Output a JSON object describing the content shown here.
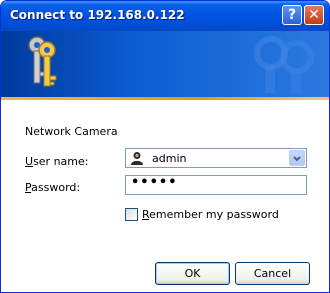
{
  "window": {
    "title": "Connect to 192.168.0.122"
  },
  "titlebar": {
    "help_icon": "help-icon",
    "close_icon": "close-icon"
  },
  "banner": {
    "icon": "keys-icon"
  },
  "form": {
    "realm": "Network Camera",
    "user_label_u": "U",
    "user_label_rest": "ser name:",
    "user_value": "admin",
    "user_icon": "user-icon",
    "password_label_u": "P",
    "password_label_rest": "assword:",
    "password_value": "•••••",
    "remember_u": "R",
    "remember_rest": "emember my password",
    "remember_checked": false
  },
  "buttons": {
    "ok": "OK",
    "cancel": "Cancel"
  },
  "colors": {
    "titlebar": "#0053e0",
    "banner": "#0b5ccf",
    "accent_line": "#e9921d",
    "dialog_bg": "#ffffff"
  }
}
